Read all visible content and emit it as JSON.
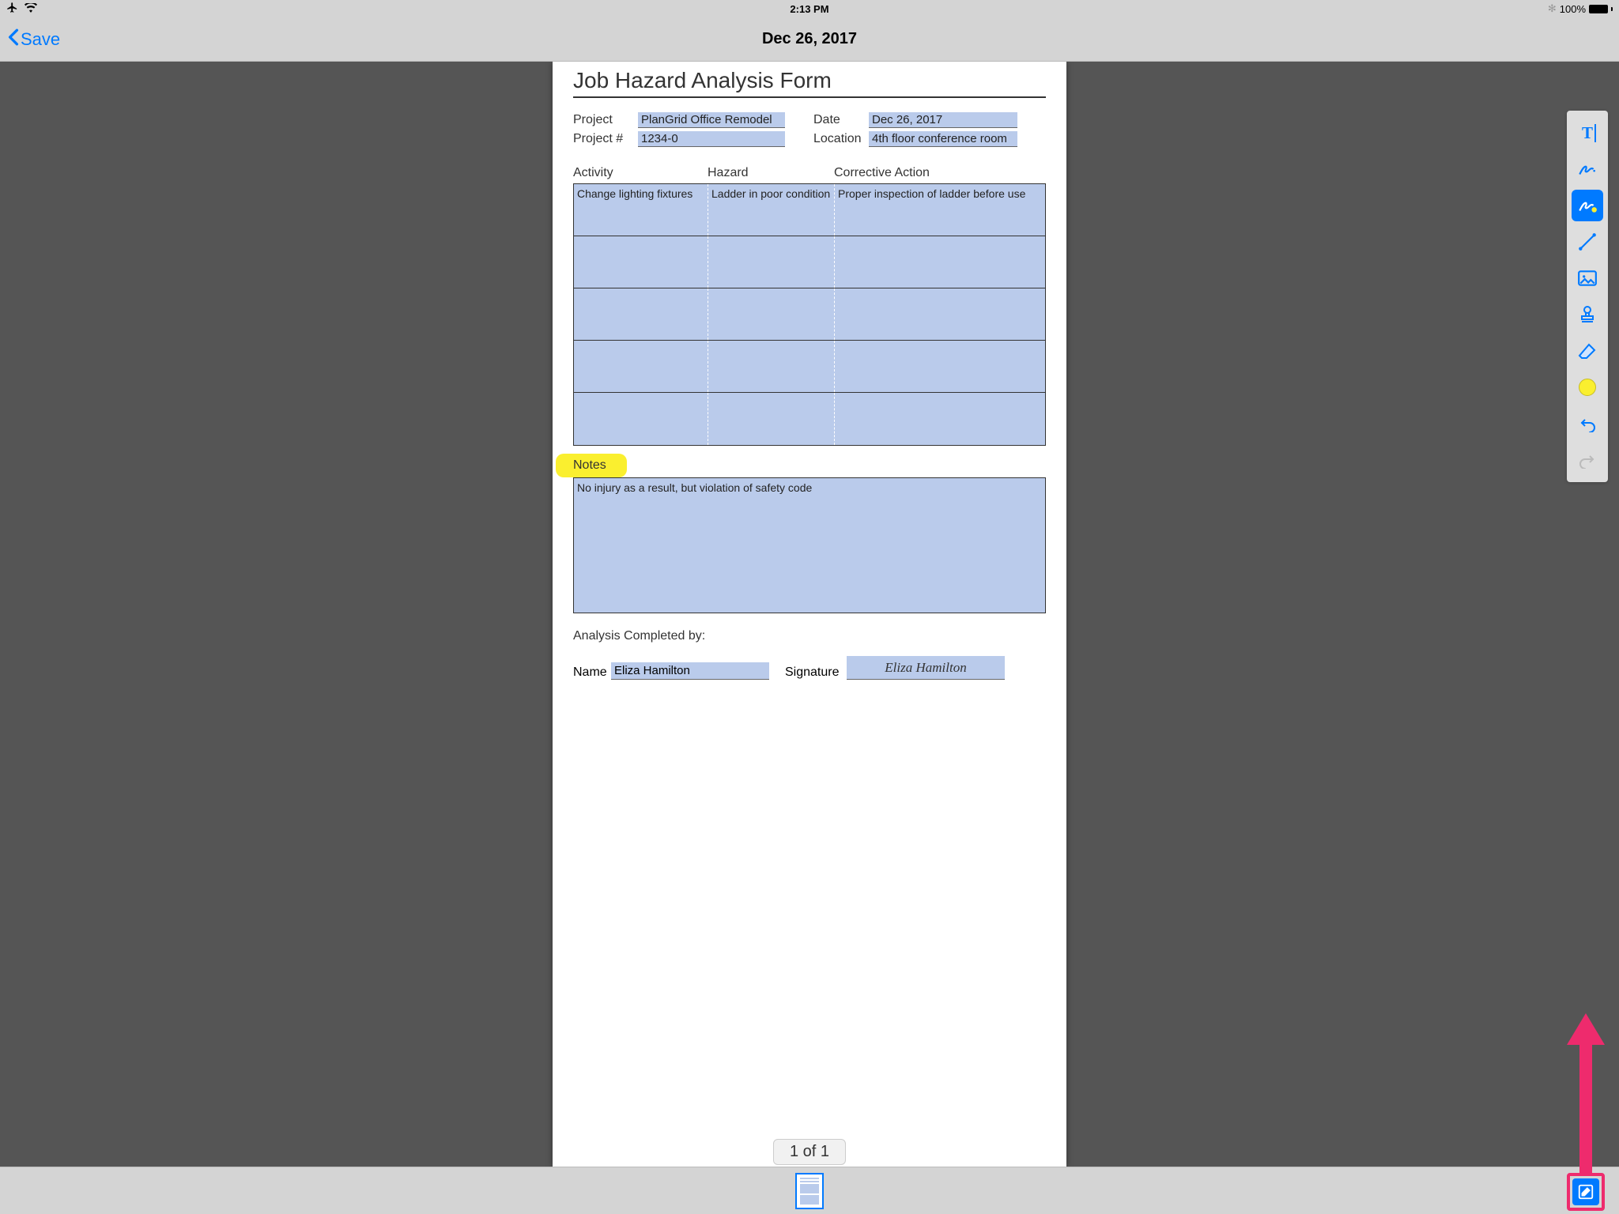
{
  "status": {
    "time": "2:13 PM",
    "battery": "100%"
  },
  "nav": {
    "back_label": "Save",
    "title": "Dec 26, 2017"
  },
  "form": {
    "title": "Job Hazard Analysis Form",
    "project_label": "Project",
    "project_value": "PlanGrid Office Remodel",
    "date_label": "Date",
    "date_value": "Dec 26, 2017",
    "projectnum_label": "Project #",
    "projectnum_value": "1234-0",
    "location_label": "Location",
    "location_value": "4th floor conference room",
    "columns": {
      "activity": "Activity",
      "hazard": "Hazard",
      "corrective": "Corrective Action"
    },
    "rows": [
      {
        "activity": "Change lighting fixtures",
        "hazard": "Ladder in poor condition",
        "corrective": "Proper inspection of ladder before use"
      },
      {
        "activity": "",
        "hazard": "",
        "corrective": ""
      },
      {
        "activity": "",
        "hazard": "",
        "corrective": ""
      },
      {
        "activity": "",
        "hazard": "",
        "corrective": ""
      },
      {
        "activity": "",
        "hazard": "",
        "corrective": ""
      }
    ],
    "notes_label": "Notes",
    "notes_value": "No injury as a result, but violation of safety code",
    "completed_label": "Analysis Completed by:",
    "name_label": "Name",
    "name_value": "Eliza Hamilton",
    "signature_label": "Signature",
    "signature_value": "Eliza Hamilton"
  },
  "page_indicator": "1 of 1",
  "toolbar": {
    "items": [
      "text",
      "freehand",
      "highlighter",
      "line",
      "image",
      "stamp",
      "eraser",
      "color",
      "undo",
      "redo"
    ],
    "selected": "highlighter",
    "color": "#faef2f"
  }
}
